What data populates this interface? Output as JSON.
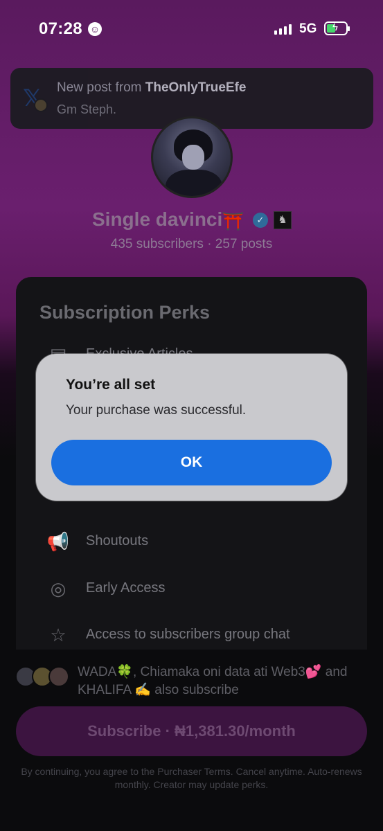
{
  "status_bar": {
    "time": "07:28",
    "network": "5G"
  },
  "notification": {
    "prefix": "New post from ",
    "author": "TheOnlyTrueEfe",
    "body": "Gm Steph."
  },
  "profile": {
    "name": "Single davinci",
    "emoji": "⛩️",
    "stats": "435 subscribers · 257 posts"
  },
  "perks": {
    "title": "Subscription Perks",
    "items": [
      {
        "label": "Exclusive Articles",
        "icon": "article-icon"
      },
      {
        "label": "Shoutouts",
        "icon": "megaphone-icon"
      },
      {
        "label": "Early Access",
        "icon": "early-access-icon"
      },
      {
        "label": "Access to subscribers group chat",
        "icon": "star-icon"
      }
    ]
  },
  "subscribers_note": "WADA🍀, Chiamaka oni data ati Web3💕 and KHALIFA ✍️ also subscribe",
  "subscribe_button": "Subscribe · ₦1,381.30/month",
  "terms": "By continuing, you agree to the Purchaser Terms. Cancel anytime. Auto-renews monthly. Creator may update perks.",
  "alert": {
    "title": "You’re all set",
    "message": "Your purchase was successful.",
    "ok": "OK"
  },
  "colors": {
    "accent": "#1a6fe0",
    "background_top": "#6a1f6e",
    "alert_bg": "#c9c9cd"
  }
}
